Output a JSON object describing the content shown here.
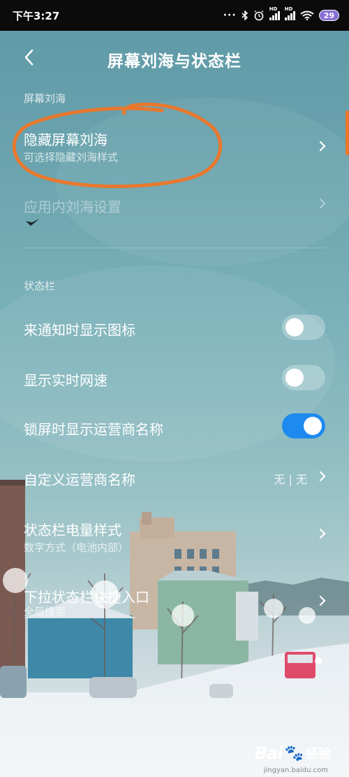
{
  "status_bar": {
    "time": "下午3:27",
    "battery": "29"
  },
  "header": {
    "title": "屏幕刘海与状态栏"
  },
  "sections": {
    "notch_label": "屏幕刘海",
    "statusbar_label": "状态栏"
  },
  "items": {
    "hide_notch": {
      "title": "隐藏屏幕刘海",
      "subtitle": "可选择隐藏刘海样式"
    },
    "in_app_notch": {
      "title": "应用内刘海设置"
    },
    "notify_icon": {
      "title": "来通知时显示图标",
      "enabled": false
    },
    "net_speed": {
      "title": "显示实时网速",
      "enabled": false
    },
    "carrier_lock": {
      "title": "锁屏时显示运营商名称",
      "enabled": true
    },
    "custom_carrier": {
      "title": "自定义运营商名称",
      "value": "无 | 无"
    },
    "battery_style": {
      "title": "状态栏电量样式",
      "subtitle": "数字方式（电池内部）"
    },
    "pulldown_shortcut": {
      "title": "下拉状态栏快捷入口",
      "subtitle": "全局搜索"
    }
  },
  "colors": {
    "toggle_on": "#1e8af0",
    "annotation": "#e8782e"
  },
  "watermark": {
    "logo": "Bai",
    "text": "经验",
    "url": "jingyan.baidu.com"
  }
}
